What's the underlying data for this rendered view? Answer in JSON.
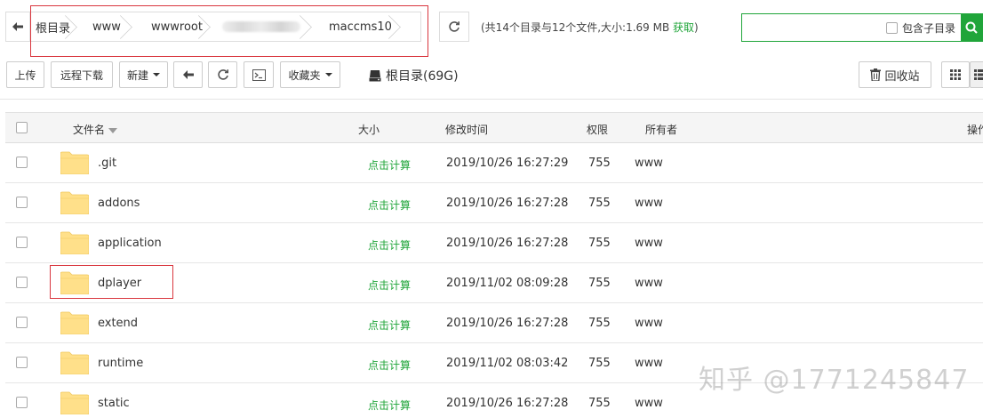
{
  "path": {
    "crumbs": [
      "根目录",
      "www",
      "wwwroot",
      "",
      "maccms10"
    ]
  },
  "summary": {
    "text": "(共14个目录与12个文件,大小:1.69 MB",
    "link": "获取",
    "close": ")"
  },
  "search": {
    "placeholder": "",
    "subdir_label": "包含子目录"
  },
  "toolbar": {
    "upload": "上传",
    "remote_download": "远程下载",
    "new": "新建",
    "favorites": "收藏夹",
    "disk": "根目录(69G)",
    "recycle": "回收站"
  },
  "table": {
    "headers": {
      "name": "文件名",
      "size": "大小",
      "mtime": "修改时间",
      "perm": "权限",
      "owner": "所有者",
      "ops": "操作"
    },
    "rows": [
      {
        "name": ".git",
        "size": "点击计算",
        "mtime": "2019/10/26 16:27:29",
        "perm": "755",
        "owner": "www"
      },
      {
        "name": "addons",
        "size": "点击计算",
        "mtime": "2019/10/26 16:27:28",
        "perm": "755",
        "owner": "www"
      },
      {
        "name": "application",
        "size": "点击计算",
        "mtime": "2019/10/26 16:27:28",
        "perm": "755",
        "owner": "www"
      },
      {
        "name": "dplayer",
        "size": "点击计算",
        "mtime": "2019/11/02 08:09:28",
        "perm": "755",
        "owner": "www"
      },
      {
        "name": "extend",
        "size": "点击计算",
        "mtime": "2019/10/26 16:27:28",
        "perm": "755",
        "owner": "www"
      },
      {
        "name": "runtime",
        "size": "点击计算",
        "mtime": "2019/11/02 08:03:42",
        "perm": "755",
        "owner": "www"
      },
      {
        "name": "static",
        "size": "点击计算",
        "mtime": "2019/10/26 16:27:28",
        "perm": "755",
        "owner": "www"
      }
    ]
  },
  "watermark": "知乎 @1771245847",
  "colors": {
    "accent": "#20a53a",
    "highlight_border": "#d9363e",
    "folder": "#ffe08a"
  }
}
